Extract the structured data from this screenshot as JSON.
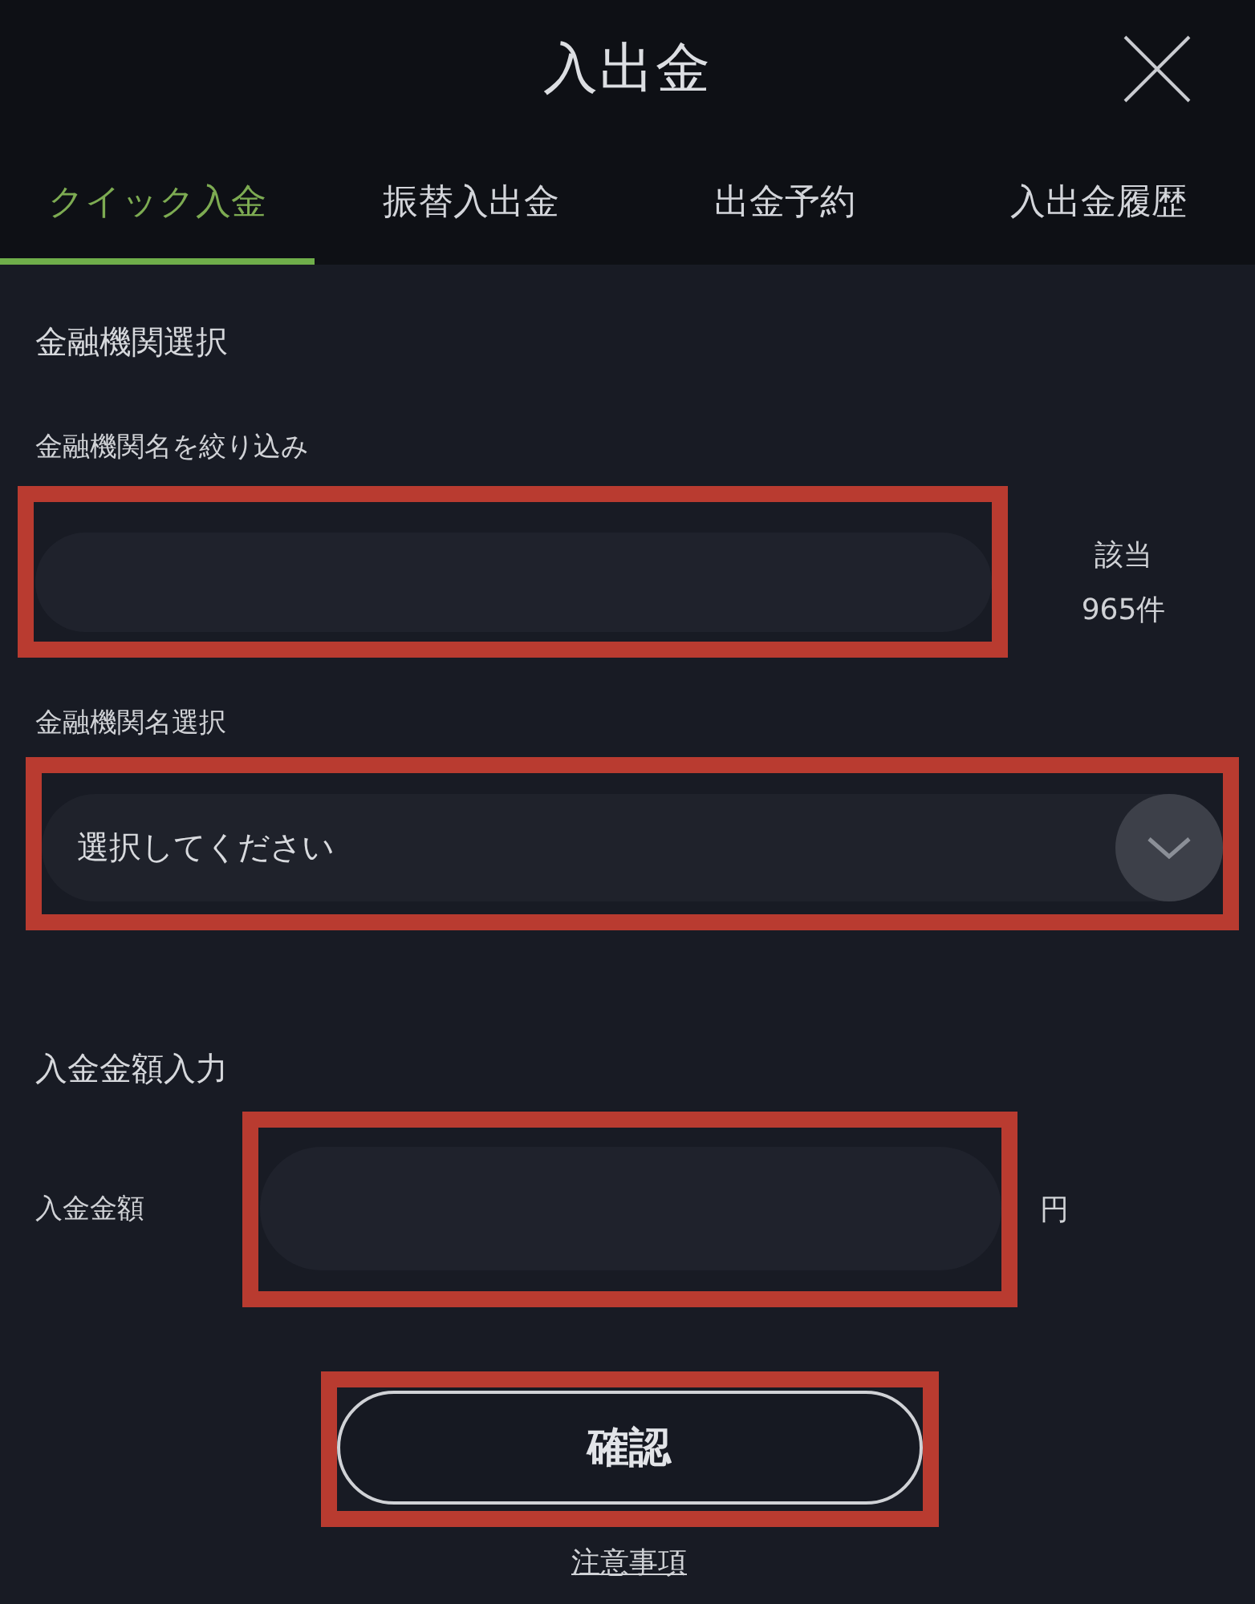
{
  "window": {
    "title": "入出金"
  },
  "tabs": [
    {
      "label": "クイック入金",
      "selected": true
    },
    {
      "label": "振替入出金",
      "selected": false
    },
    {
      "label": "出金予約",
      "selected": false
    },
    {
      "label": "入出金履歴",
      "selected": false
    }
  ],
  "bank_section": {
    "title": "金融機関選択",
    "filter": {
      "label": "金融機関名を絞り込み",
      "highlighted": true
    },
    "match_count": {
      "label": "該当",
      "count": "965件"
    },
    "select": {
      "label": "金融機関名選択",
      "placeholder": "選択してください",
      "highlighted": true
    }
  },
  "amount_section": {
    "title": "入金金額入力",
    "label": "入金金額",
    "unit": "円",
    "highlighted": true
  },
  "confirm_button": {
    "label": "確認",
    "highlighted": true
  },
  "notice_link": "注意事項"
}
